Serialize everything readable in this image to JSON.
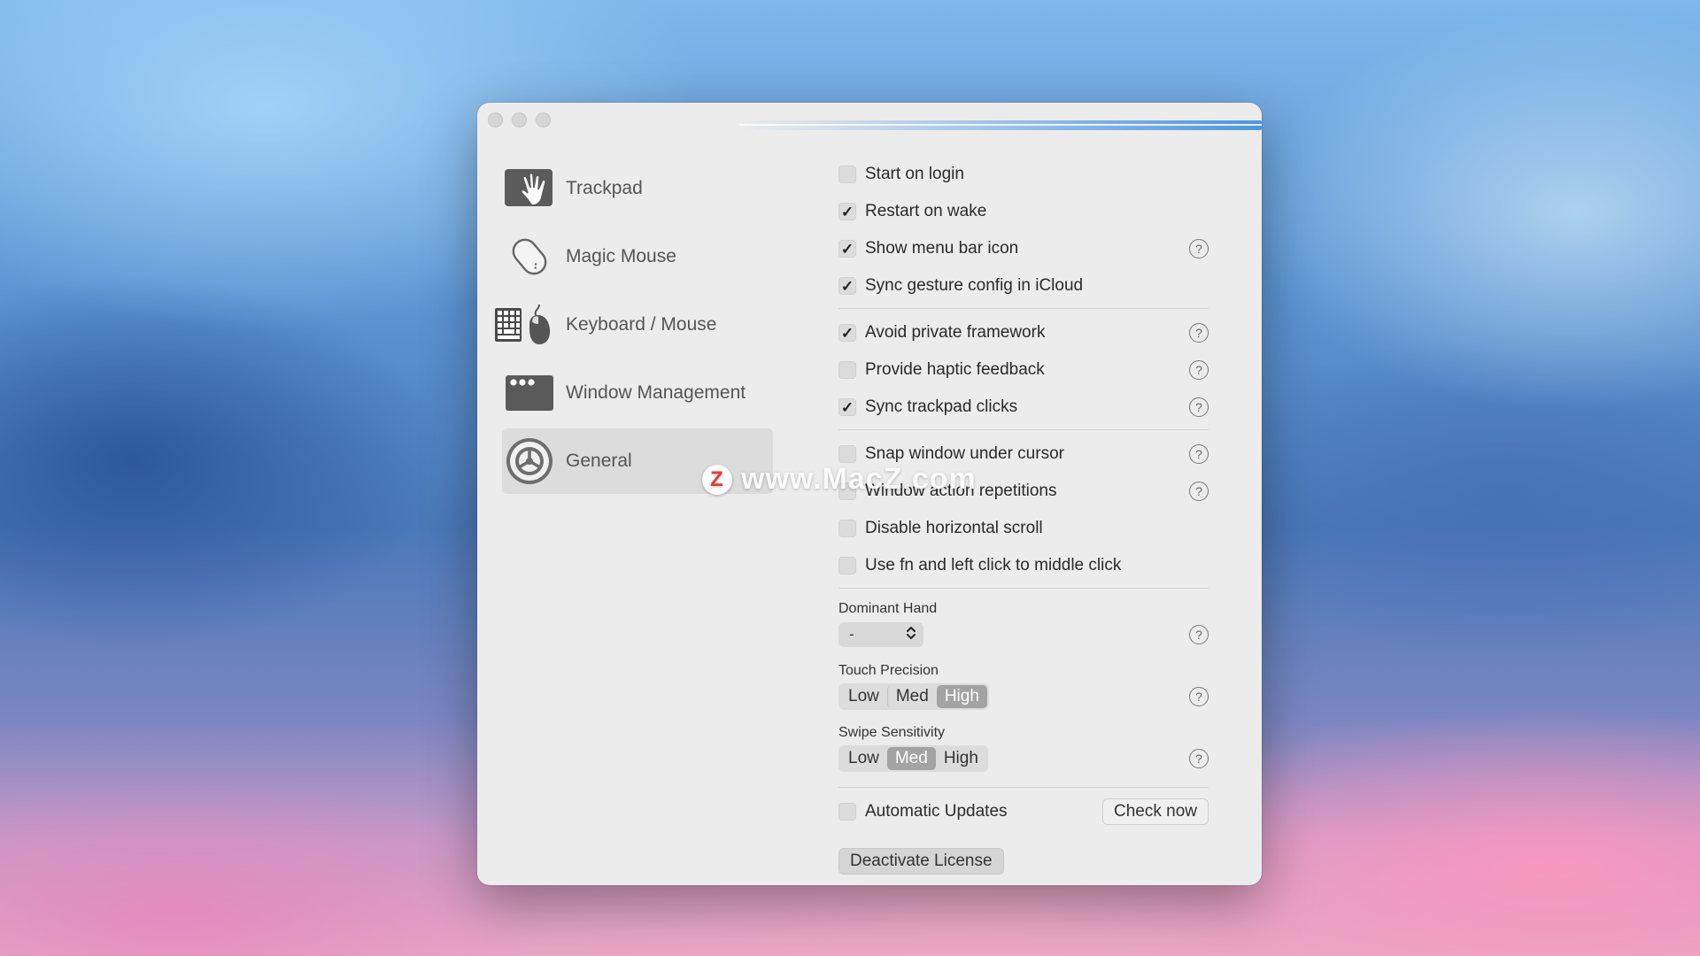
{
  "sidebar": {
    "items": [
      {
        "label": "Trackpad",
        "icon": "trackpad-icon",
        "selected": false
      },
      {
        "label": "Magic Mouse",
        "icon": "magic-mouse-icon",
        "selected": false
      },
      {
        "label": "Keyboard / Mouse",
        "icon": "keyboard-mouse-icon",
        "selected": false
      },
      {
        "label": "Window Management",
        "icon": "window-management-icon",
        "selected": false
      },
      {
        "label": "General",
        "icon": "gear-icon",
        "selected": true
      }
    ]
  },
  "options": {
    "start_on_login": {
      "label": "Start on login",
      "checked": false
    },
    "restart_on_wake": {
      "label": "Restart on wake",
      "checked": true
    },
    "show_menu_bar_icon": {
      "label": "Show menu bar icon",
      "checked": true
    },
    "sync_gesture_config": {
      "label": "Sync gesture config in iCloud",
      "checked": true
    },
    "avoid_private_framework": {
      "label": "Avoid private framework",
      "checked": true
    },
    "provide_haptic_feedback": {
      "label": "Provide haptic feedback",
      "checked": false
    },
    "sync_trackpad_clicks": {
      "label": "Sync trackpad clicks",
      "checked": true
    },
    "snap_window_under_cursor": {
      "label": "Snap window under cursor",
      "checked": false
    },
    "window_action_repetitions": {
      "label": "Window action repetitions",
      "checked": false
    },
    "disable_horizontal_scroll": {
      "label": "Disable horizontal scroll",
      "checked": false
    },
    "fn_left_click_middle": {
      "label": "Use fn and left click to middle click",
      "checked": false
    }
  },
  "dominant_hand": {
    "label": "Dominant Hand",
    "value": "-"
  },
  "touch_precision": {
    "label": "Touch Precision",
    "options": [
      "Low",
      "Med",
      "High"
    ],
    "selected": "High"
  },
  "swipe_sensitivity": {
    "label": "Swipe Sensitivity",
    "options": [
      "Low",
      "Med",
      "High"
    ],
    "selected": "Med"
  },
  "updates": {
    "label": "Automatic Updates",
    "checked": false,
    "check_now": "Check now"
  },
  "deactivate_license": "Deactivate License",
  "help_glyph": "?",
  "check_glyph": "✓",
  "stepper_glyph": "⌃⌄",
  "watermark": {
    "logo": "Z",
    "text": "www.MacZ.com"
  },
  "colors": {
    "accent": "#4d95e3",
    "segment_active": "#a3a3a3"
  }
}
